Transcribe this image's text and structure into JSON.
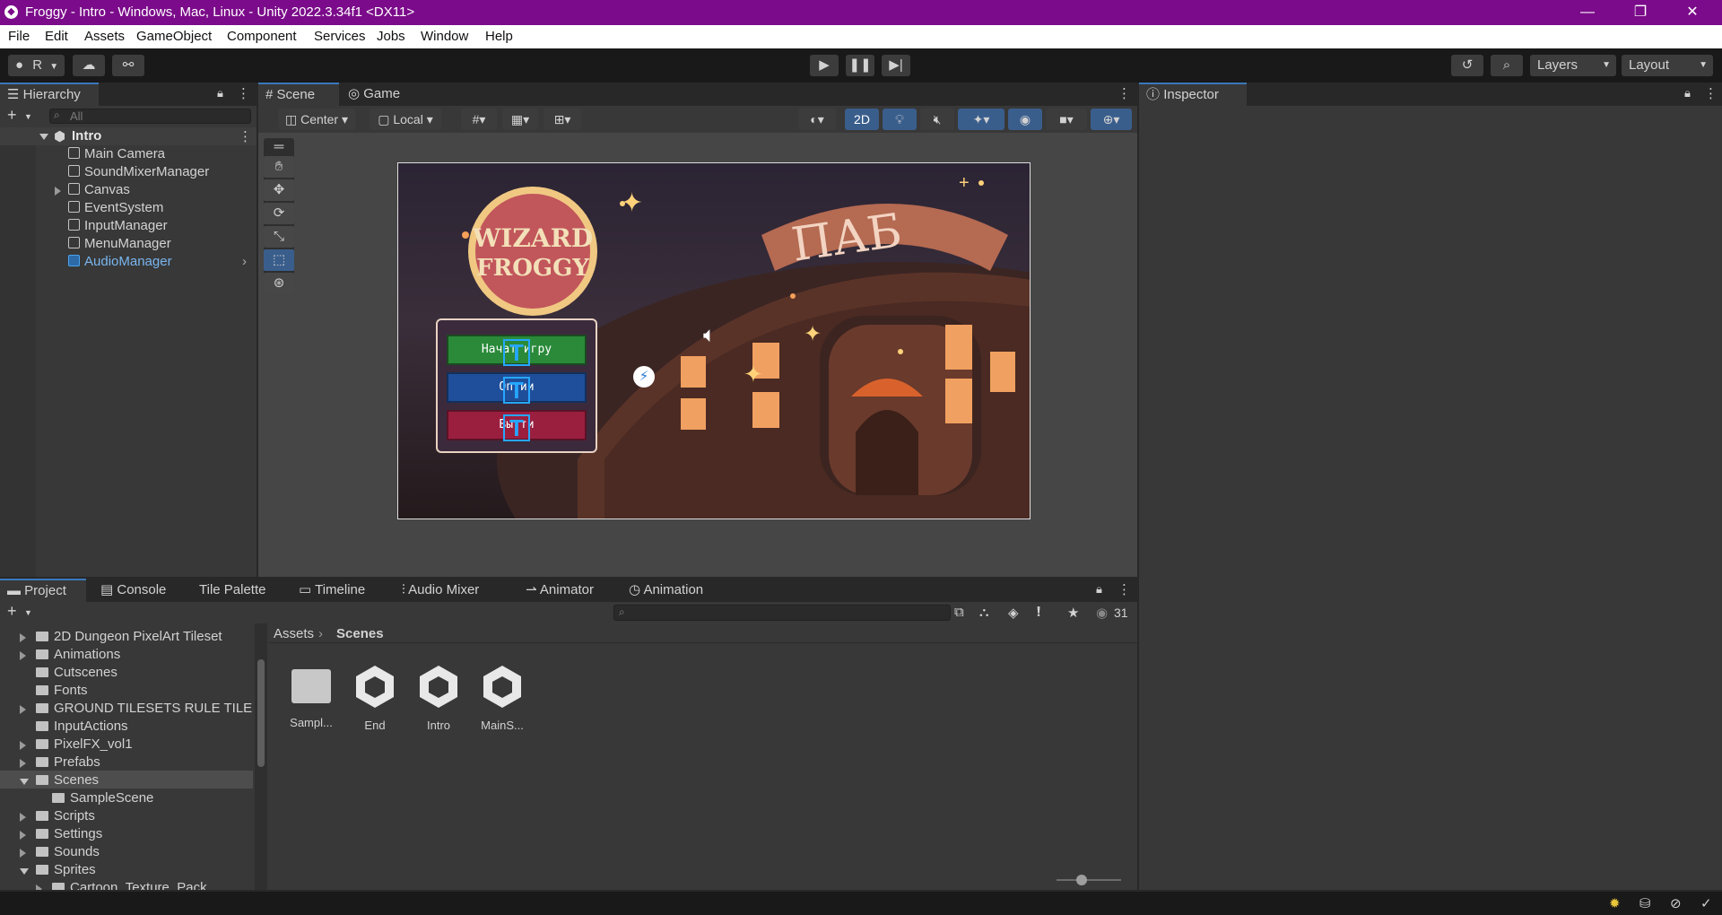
{
  "window": {
    "title": "Froggy - Intro - Windows, Mac, Linux - Unity 2022.3.34f1 <DX11>",
    "controls": [
      "—",
      "❐",
      "✕"
    ]
  },
  "menu": [
    "File",
    "Edit",
    "Assets",
    "GameObject",
    "Component",
    "Services",
    "Jobs",
    "Window",
    "Help"
  ],
  "toolbar": {
    "account_label": "R",
    "layers_label": "Layers",
    "layout_label": "Layout"
  },
  "hierarchy": {
    "tab_label": "Hierarchy",
    "search_placeholder": "All",
    "scene_name": "Intro",
    "items": [
      "Main Camera",
      "SoundMixerManager",
      "Canvas",
      "EventSystem",
      "InputManager",
      "MenuManager",
      "AudioManager"
    ]
  },
  "scene_view": {
    "tabs": [
      "Scene",
      "Game"
    ],
    "pivot_label": "Center",
    "space_label": "Local",
    "mode_2d_label": "2D",
    "game": {
      "logo_line1": "WIZARD",
      "logo_line2": "FROGGY",
      "sign": "ПАБ",
      "buttons": [
        "Начат игру",
        "Оп ии",
        "Вы ти"
      ]
    }
  },
  "inspector": {
    "tab_label": "Inspector"
  },
  "bottom_tabs": [
    "Project",
    "Console",
    "Tile Palette",
    "Timeline",
    "Audio Mixer",
    "Animator",
    "Animation"
  ],
  "project": {
    "hidden_count": "31",
    "breadcrumb": [
      "Assets",
      "Scenes"
    ],
    "tree": [
      {
        "label": "2D Dungeon PixelArt Tileset",
        "arrow": true
      },
      {
        "label": "Animations",
        "arrow": true
      },
      {
        "label": "Cutscenes",
        "arrow": false
      },
      {
        "label": "Fonts",
        "arrow": false
      },
      {
        "label": "GROUND TILESETS RULE TILES",
        "arrow": true
      },
      {
        "label": "InputActions",
        "arrow": false
      },
      {
        "label": "PixelFX_vol1",
        "arrow": true
      },
      {
        "label": "Prefabs",
        "arrow": true
      },
      {
        "label": "Scenes",
        "arrow": true
      },
      {
        "label": "SampleScene",
        "arrow": false
      },
      {
        "label": "Scripts",
        "arrow": true
      },
      {
        "label": "Settings",
        "arrow": true
      },
      {
        "label": "Sounds",
        "arrow": true
      },
      {
        "label": "Sprites",
        "arrow": true
      },
      {
        "label": "Cartoon_Texture_Pack",
        "arrow": true
      }
    ],
    "assets": [
      "Sampl...",
      "End",
      "Intro",
      "MainS..."
    ]
  },
  "colors": {
    "title_bar": "#7b0b8a",
    "selection_blue": "#3a79bb",
    "active_item": "#79b6ef"
  }
}
